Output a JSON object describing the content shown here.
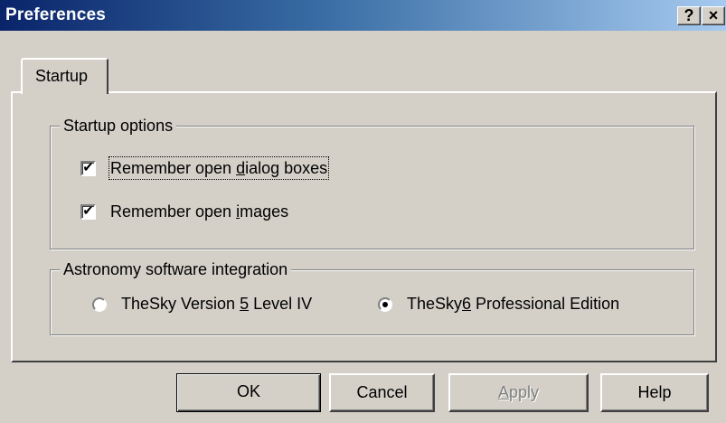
{
  "window": {
    "title": "Preferences",
    "help_glyph": "?",
    "close_glyph": "×"
  },
  "tabs": [
    {
      "label": "Startup",
      "selected": true
    }
  ],
  "startup_options": {
    "legend": "Startup options",
    "remember_dialogs": {
      "label": "Remember open dialog boxes",
      "checked": true
    },
    "remember_images": {
      "label": "Remember open images",
      "checked": true
    }
  },
  "astronomy": {
    "legend": "Astronomy software integration",
    "options": [
      {
        "label": "TheSky Version 5 Level IV",
        "selected": false
      },
      {
        "label": "TheSky6 Professional Edition",
        "selected": true
      }
    ]
  },
  "buttons": {
    "ok": "OK",
    "cancel": "Cancel",
    "apply": "Apply",
    "help": "Help"
  },
  "check_glyph": "✔"
}
